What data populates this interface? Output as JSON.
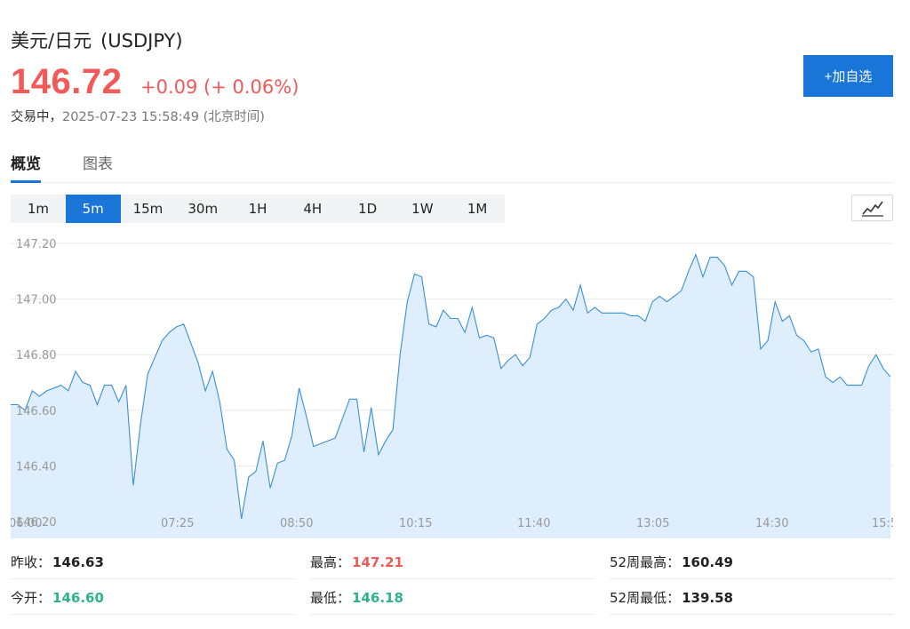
{
  "header": {
    "name": "美元/日元",
    "code": "(USDJPY)",
    "price": "146.72",
    "change": "+0.09 (+ 0.06%)",
    "status": "交易中，",
    "timestamp": "2025-07-23 15:58:49 (北京时间)",
    "watch_button": "+加自选"
  },
  "tabs": [
    {
      "label": "概览",
      "active": true
    },
    {
      "label": "图表",
      "active": false
    }
  ],
  "intervals": [
    "1m",
    "5m",
    "15m",
    "30m",
    "1H",
    "4H",
    "1D",
    "1W",
    "1M"
  ],
  "active_interval": "5m",
  "chart_data": {
    "type": "area",
    "y_ticks": [
      "147.20",
      "147.00",
      "146.80",
      "146.60",
      "146.40",
      "146.20"
    ],
    "ylim": [
      146.2,
      147.2
    ],
    "x_ticks": [
      "06:00",
      "07:25",
      "08:50",
      "10:15",
      "11:40",
      "13:05",
      "14:30",
      "15:5"
    ],
    "values": [
      146.62,
      146.62,
      146.6,
      146.67,
      146.65,
      146.67,
      146.68,
      146.69,
      146.67,
      146.74,
      146.7,
      146.69,
      146.62,
      146.69,
      146.69,
      146.63,
      146.69,
      146.33,
      146.55,
      146.73,
      146.79,
      146.85,
      146.88,
      146.9,
      146.91,
      146.84,
      146.77,
      146.67,
      146.74,
      146.63,
      146.46,
      146.42,
      146.21,
      146.36,
      146.38,
      146.49,
      146.32,
      146.41,
      146.42,
      146.51,
      146.68,
      146.58,
      146.47,
      146.48,
      146.49,
      146.5,
      146.57,
      146.64,
      146.64,
      146.45,
      146.61,
      146.44,
      146.49,
      146.53,
      146.8,
      146.99,
      147.09,
      147.08,
      146.91,
      146.9,
      146.96,
      146.93,
      146.93,
      146.88,
      146.97,
      146.86,
      146.87,
      146.86,
      146.75,
      146.78,
      146.8,
      146.76,
      146.79,
      146.91,
      146.93,
      146.96,
      146.97,
      147.0,
      146.96,
      147.05,
      146.95,
      146.97,
      146.95,
      146.95,
      146.95,
      146.95,
      146.94,
      146.94,
      146.92,
      146.99,
      147.01,
      146.99,
      147.01,
      147.03,
      147.1,
      147.16,
      147.08,
      147.15,
      147.15,
      147.12,
      147.05,
      147.1,
      147.1,
      147.08,
      146.82,
      146.85,
      146.99,
      146.92,
      146.94,
      146.87,
      146.85,
      146.81,
      146.82,
      146.72,
      146.7,
      146.72,
      146.69,
      146.69,
      146.69,
      146.76,
      146.8,
      146.75,
      146.72
    ],
    "line_color": "#3a8fd6",
    "fill_color": "#dfeefc"
  },
  "stats": [
    {
      "label": "昨收：",
      "value": "146.63",
      "tone": "neutral"
    },
    {
      "label": "最高：",
      "value": "147.21",
      "tone": "up"
    },
    {
      "label": "52周最高：",
      "value": "160.49",
      "tone": "neutral"
    },
    {
      "label": "今开：",
      "value": "146.60",
      "tone": "down"
    },
    {
      "label": "最低：",
      "value": "146.18",
      "tone": "down"
    },
    {
      "label": "52周最低：",
      "value": "139.58",
      "tone": "neutral"
    }
  ],
  "colors": {
    "accent": "#1a75d9",
    "up": "#f25959",
    "down": "#2eb38a"
  },
  "icons": {
    "chart_type": "line-chart-icon"
  }
}
